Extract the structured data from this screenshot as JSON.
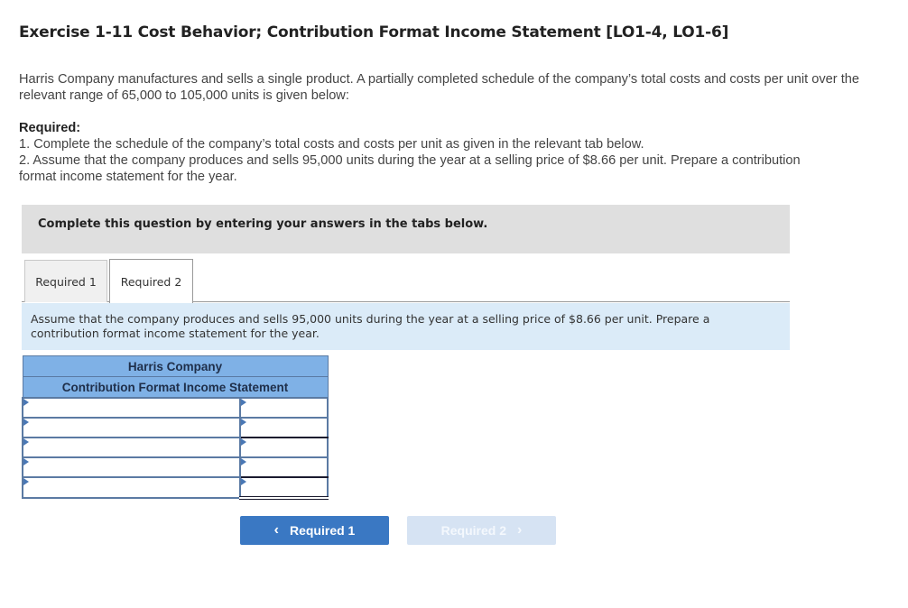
{
  "page": {
    "title": "Exercise 1-11 Cost Behavior; Contribution Format Income Statement [LO1-4, LO1-6]",
    "intro": "Harris Company manufactures and sells a single product. A partially completed schedule of the company’s total costs and costs per unit over the relevant range of 65,000 to 105,000 units is given below:",
    "required": {
      "heading": "Required:",
      "items": [
        "1. Complete the schedule of the company’s total costs and costs per unit as given in the relevant tab below.",
        "2. Assume that the company produces and sells 95,000 units during the year at a selling price of $8.66 per unit. Prepare a contribution format income statement for the year."
      ]
    }
  },
  "instruction_bar": {
    "text": "Complete this question by entering your answers in the tabs below."
  },
  "tabs": [
    {
      "label": "Required 1",
      "active": false
    },
    {
      "label": "Required 2",
      "active": true
    }
  ],
  "prompt": "Assume that the company produces and sells 95,000 units during the year at a selling price of $8.66 per unit. Prepare a contribution format income statement for the year.",
  "statement": {
    "company": "Harris Company",
    "title": "Contribution Format Income Statement",
    "rows": [
      {
        "label": "",
        "amount": ""
      },
      {
        "label": "",
        "amount": ""
      },
      {
        "label": "",
        "amount": ""
      },
      {
        "label": "",
        "amount": ""
      },
      {
        "label": "",
        "amount": ""
      }
    ]
  },
  "navigation": {
    "prev": {
      "label": "Required 1",
      "icon": "chevron-left-icon",
      "glyph": "‹",
      "enabled": true
    },
    "next": {
      "label": "Required 2",
      "icon": "chevron-right-icon",
      "glyph": "›",
      "enabled": false
    }
  },
  "colors": {
    "instruction_bar_bg": "#dfdfdf",
    "prompt_bg": "#dbebf8",
    "statement_header_bg": "#7fb1e6",
    "statement_border": "#5b7aa3",
    "primary_button": "#3a78c3",
    "disabled_button": "#d6e3f3"
  }
}
